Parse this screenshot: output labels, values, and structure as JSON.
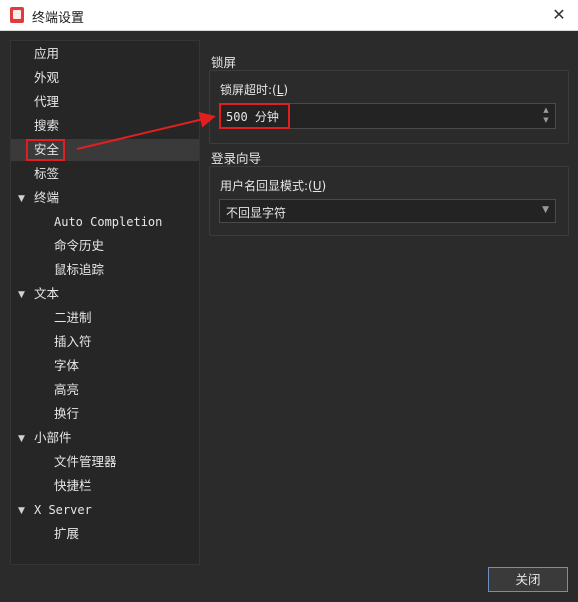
{
  "window": {
    "title": "终端设置",
    "close_icon": "close-icon"
  },
  "tree": {
    "items": [
      {
        "label": "应用"
      },
      {
        "label": "外观"
      },
      {
        "label": "代理"
      },
      {
        "label": "搜索"
      },
      {
        "label": "安全",
        "selected": true
      },
      {
        "label": "标签"
      },
      {
        "label": "终端",
        "expandable": true
      },
      {
        "label": "Auto Completion"
      },
      {
        "label": "命令历史"
      },
      {
        "label": "鼠标追踪"
      },
      {
        "label": "文本",
        "expandable": true
      },
      {
        "label": "二进制"
      },
      {
        "label": "插入符"
      },
      {
        "label": "字体"
      },
      {
        "label": "高亮"
      },
      {
        "label": "换行"
      },
      {
        "label": "小部件",
        "expandable": true
      },
      {
        "label": "文件管理器"
      },
      {
        "label": "快捷栏"
      },
      {
        "label": "X Server",
        "expandable": true
      },
      {
        "label": "扩展"
      }
    ]
  },
  "lock_section": {
    "title": "锁屏",
    "timeout_label_prefix": "锁屏超时:(",
    "timeout_label_key": "L",
    "timeout_label_suffix": ")",
    "timeout_value": "500 分钟"
  },
  "login_section": {
    "title": "登录向导",
    "echo_label_prefix": "用户名回显模式:(",
    "echo_label_key": "U",
    "echo_label_suffix": ")",
    "echo_value": "不回显字符"
  },
  "footer": {
    "close_label": "关闭"
  },
  "colors": {
    "accent": "#e02020",
    "background": "#2b2b2b",
    "button_border": "#6b8fbf"
  }
}
